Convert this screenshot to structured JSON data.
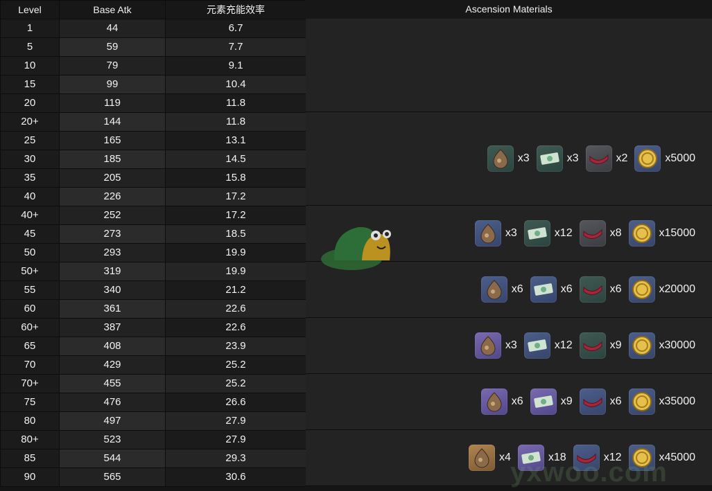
{
  "columns": [
    "Level",
    "Base Atk",
    "元素充能效率"
  ],
  "materials_header": "Ascension Materials",
  "rows": [
    {
      "level": "1",
      "atk": "44",
      "er": "6.7"
    },
    {
      "level": "5",
      "atk": "59",
      "er": "7.7"
    },
    {
      "level": "10",
      "atk": "79",
      "er": "9.1"
    },
    {
      "level": "15",
      "atk": "99",
      "er": "10.4"
    },
    {
      "level": "20",
      "atk": "119",
      "er": "11.8"
    },
    {
      "level": "20+",
      "atk": "144",
      "er": "11.8"
    },
    {
      "level": "25",
      "atk": "165",
      "er": "13.1"
    },
    {
      "level": "30",
      "atk": "185",
      "er": "14.5"
    },
    {
      "level": "35",
      "atk": "205",
      "er": "15.8"
    },
    {
      "level": "40",
      "atk": "226",
      "er": "17.2"
    },
    {
      "level": "40+",
      "atk": "252",
      "er": "17.2"
    },
    {
      "level": "45",
      "atk": "273",
      "er": "18.5"
    },
    {
      "level": "50",
      "atk": "293",
      "er": "19.9"
    },
    {
      "level": "50+",
      "atk": "319",
      "er": "19.9"
    },
    {
      "level": "55",
      "atk": "340",
      "er": "21.2"
    },
    {
      "level": "60",
      "atk": "361",
      "er": "22.6"
    },
    {
      "level": "60+",
      "atk": "387",
      "er": "22.6"
    },
    {
      "level": "65",
      "atk": "408",
      "er": "23.9"
    },
    {
      "level": "70",
      "atk": "429",
      "er": "25.2"
    },
    {
      "level": "70+",
      "atk": "455",
      "er": "25.2"
    },
    {
      "level": "75",
      "atk": "476",
      "er": "26.6"
    },
    {
      "level": "80",
      "atk": "497",
      "er": "27.9"
    },
    {
      "level": "80+",
      "atk": "523",
      "er": "27.9"
    },
    {
      "level": "85",
      "atk": "544",
      "er": "29.3"
    },
    {
      "level": "90",
      "atk": "565",
      "er": "30.6"
    }
  ],
  "ascension": [
    {
      "items": []
    },
    {
      "items": [
        {
          "icon": "weapon-material-icon",
          "tier": "green",
          "count": "x3"
        },
        {
          "icon": "elite-drop-icon",
          "tier": "green",
          "count": "x3"
        },
        {
          "icon": "common-drop-icon",
          "tier": "gray",
          "count": "x2"
        },
        {
          "icon": "mora-coin-icon",
          "tier": "blue",
          "count": "x5000"
        }
      ]
    },
    {
      "items": [
        {
          "icon": "weapon-material-icon",
          "tier": "blue",
          "count": "x3"
        },
        {
          "icon": "elite-drop-icon",
          "tier": "green",
          "count": "x12"
        },
        {
          "icon": "common-drop-icon",
          "tier": "gray",
          "count": "x8"
        },
        {
          "icon": "mora-coin-icon",
          "tier": "blue",
          "count": "x15000"
        }
      ]
    },
    {
      "items": [
        {
          "icon": "weapon-material-icon",
          "tier": "blue",
          "count": "x6"
        },
        {
          "icon": "elite-drop-icon",
          "tier": "blue",
          "count": "x6"
        },
        {
          "icon": "common-drop-icon",
          "tier": "green",
          "count": "x6"
        },
        {
          "icon": "mora-coin-icon",
          "tier": "blue",
          "count": "x20000"
        }
      ]
    },
    {
      "items": [
        {
          "icon": "weapon-material-icon",
          "tier": "purple",
          "count": "x3"
        },
        {
          "icon": "elite-drop-icon",
          "tier": "blue",
          "count": "x12"
        },
        {
          "icon": "common-drop-icon",
          "tier": "green",
          "count": "x9"
        },
        {
          "icon": "mora-coin-icon",
          "tier": "blue",
          "count": "x30000"
        }
      ]
    },
    {
      "items": [
        {
          "icon": "weapon-material-icon",
          "tier": "purple",
          "count": "x6"
        },
        {
          "icon": "elite-drop-icon",
          "tier": "purple",
          "count": "x9"
        },
        {
          "icon": "common-drop-icon",
          "tier": "blue",
          "count": "x6"
        },
        {
          "icon": "mora-coin-icon",
          "tier": "blue",
          "count": "x35000"
        }
      ]
    },
    {
      "items": [
        {
          "icon": "weapon-material-icon",
          "tier": "gold",
          "count": "x4"
        },
        {
          "icon": "elite-drop-icon",
          "tier": "purple",
          "count": "x18"
        },
        {
          "icon": "common-drop-icon",
          "tier": "blue",
          "count": "x12"
        },
        {
          "icon": "mora-coin-icon",
          "tier": "blue",
          "count": "x45000"
        }
      ]
    }
  ],
  "watermark": "yxwoo.com"
}
